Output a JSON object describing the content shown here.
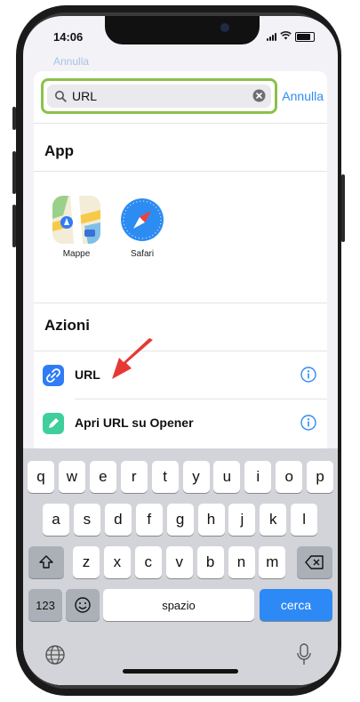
{
  "status_bar": {
    "time": "14:06"
  },
  "behind_sheet": {
    "cancel_hint": "Annulla"
  },
  "search": {
    "value": "URL",
    "cancel_label": "Annulla"
  },
  "apps_section": {
    "title": "App",
    "apps": [
      {
        "label": "Mappe",
        "icon": "maps-app-icon"
      },
      {
        "label": "Safari",
        "icon": "safari-app-icon"
      }
    ]
  },
  "actions_section": {
    "title": "Azioni",
    "items": [
      {
        "label": "URL",
        "icon": "link-icon",
        "color": "#2f7cf6"
      },
      {
        "label": "Apri URL su Opener",
        "icon": "pencil-icon",
        "color": "#3fcf9c"
      }
    ]
  },
  "keyboard": {
    "row1": [
      "q",
      "w",
      "e",
      "r",
      "t",
      "y",
      "u",
      "i",
      "o",
      "p"
    ],
    "row2": [
      "a",
      "s",
      "d",
      "f",
      "g",
      "h",
      "j",
      "k",
      "l"
    ],
    "row3": [
      "z",
      "x",
      "c",
      "v",
      "b",
      "n",
      "m"
    ],
    "numbers_label": "123",
    "space_label": "spazio",
    "search_label": "cerca"
  },
  "colors": {
    "accent": "#2f8cf0",
    "highlight": "#8ac24a",
    "arrow": "#e53935"
  }
}
